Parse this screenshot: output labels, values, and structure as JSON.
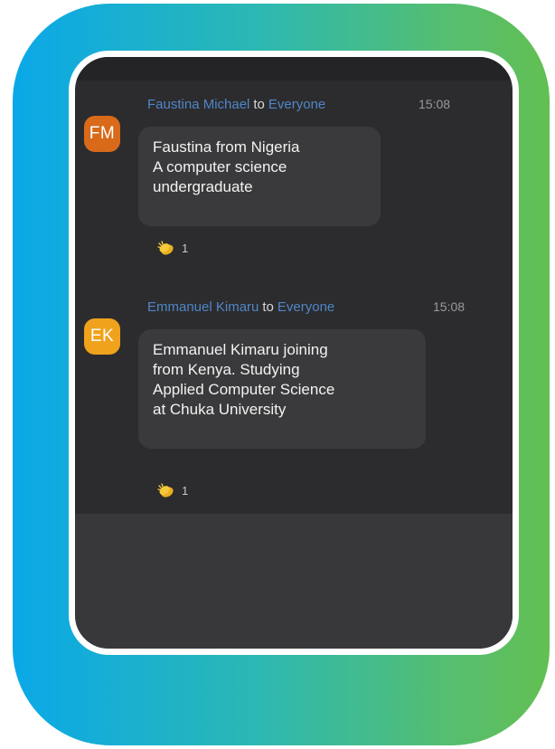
{
  "messages": [
    {
      "avatar_initials": "FM",
      "avatar_color": "#d86a1a",
      "sender": "Faustina Michael",
      "to_label": "to",
      "recipient": "Everyone",
      "time": "15:08",
      "lines": [
        "Faustina from Nigeria",
        "A computer science",
        "undergraduate"
      ],
      "reaction": {
        "icon": "clapping-hands-icon",
        "count": "1"
      }
    },
    {
      "avatar_initials": "EK",
      "avatar_color": "#f0a21c",
      "sender": "Emmanuel Kimaru",
      "to_label": "to",
      "recipient": "Everyone",
      "time": "15:08",
      "lines": [
        "Emmanuel Kimaru joining",
        "from Kenya. Studying",
        "Applied Computer Science",
        "at Chuka University"
      ],
      "reaction": {
        "icon": "clapping-hands-icon",
        "count": "1"
      }
    }
  ],
  "colors": {
    "frame_gradient_start": "#0aa8e8",
    "frame_gradient_end": "#63bf52",
    "chat_background": "#2c2c2e",
    "bubble_background": "#3a3a3c",
    "name_link": "#4f86c8"
  }
}
